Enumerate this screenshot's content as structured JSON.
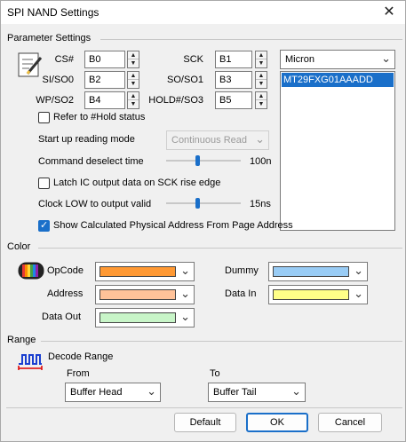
{
  "window": {
    "title": "SPI NAND Settings",
    "close_glyph": "✕"
  },
  "params": {
    "group_title": "Parameter Settings",
    "cs_label": "CS#",
    "cs_value": "B0",
    "sck_label": "SCK",
    "sck_value": "B1",
    "si_label": "SI/SO0",
    "si_value": "B2",
    "so_label": "SO/SO1",
    "so_value": "B3",
    "wp_label": "WP/SO2",
    "wp_value": "B4",
    "hold_label": "HOLD#/SO3",
    "hold_value": "B5",
    "vendor": "Micron",
    "device_selected": "MT29FXG01AAADD",
    "refer_hold_label": "Refer to #Hold status",
    "startup_label": "Start up reading mode",
    "startup_value": "Continuous Read",
    "cmd_deselect_label": "Command deselect time",
    "cmd_deselect_value": "100n",
    "latch_label": "Latch IC output data on SCK rise edge",
    "clock_low_label": "Clock LOW to output valid",
    "clock_low_value": "15ns",
    "show_calc_label": "Show Calculated Physical Address From Page Address"
  },
  "color": {
    "group_title": "Color",
    "opcode_label": "OpCode",
    "opcode_color": "#ff9933",
    "dummy_label": "Dummy",
    "dummy_color": "#99ccf5",
    "address_label": "Address",
    "address_color": "#ffc299",
    "datain_label": "Data In",
    "datain_color": "#ffff88",
    "dataout_label": "Data Out",
    "dataout_color": "#c8f5c8"
  },
  "range": {
    "group_title": "Range",
    "decode_label": "Decode Range",
    "from_label": "From",
    "from_value": "Buffer Head",
    "to_label": "To",
    "to_value": "Buffer Tail"
  },
  "buttons": {
    "default": "Default",
    "ok": "OK",
    "cancel": "Cancel"
  },
  "state": {
    "refer_hold": false,
    "latch": false,
    "show_calc": true,
    "cmd_deselect_level": 0.42,
    "clock_low_level": 0.42
  },
  "accent": "#1a6fc9"
}
